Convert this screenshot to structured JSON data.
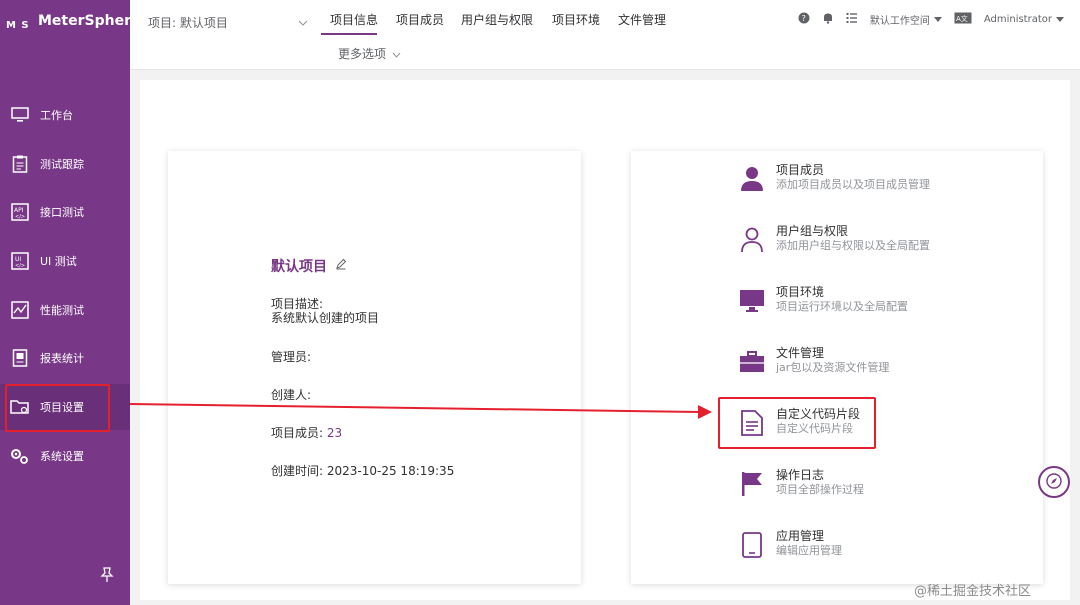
{
  "app": {
    "name": "MeterSphere",
    "mark": "M S"
  },
  "sidebar": {
    "items": [
      {
        "label": "工作台",
        "icon": "monitor-icon"
      },
      {
        "label": "测试跟踪",
        "icon": "clipboard-icon"
      },
      {
        "label": "接口测试",
        "icon": "api-icon"
      },
      {
        "label": "UI 测试",
        "icon": "ui-icon"
      },
      {
        "label": "性能测试",
        "icon": "performance-icon"
      },
      {
        "label": "报表统计",
        "icon": "report-icon"
      },
      {
        "label": "项目设置",
        "icon": "folder-gear-icon"
      },
      {
        "label": "系统设置",
        "icon": "gears-icon"
      }
    ],
    "active_index": 6,
    "pin_icon": "pin-icon"
  },
  "topbar": {
    "project_select": "项目: 默认项目",
    "tabs": [
      "项目信息",
      "项目成员",
      "用户组与权限",
      "项目环境",
      "文件管理"
    ],
    "active_tab": "项目信息",
    "more": "更多选项",
    "workspace": "默认工作空间",
    "user": "Administrator"
  },
  "project": {
    "name": "默认项目",
    "desc_label": "项目描述:",
    "desc_value": "系统默认创建的项目",
    "manager_label": "管理员:",
    "creator_label": "创建人:",
    "members_label": "项目成员:",
    "members_value": "23",
    "created_label": "创建时间:",
    "created_value": "2023-10-25 18:19:35"
  },
  "menu": [
    {
      "title": "项目成员",
      "sub": "添加项目成员以及项目成员管理",
      "icon": "user-icon"
    },
    {
      "title": "用户组与权限",
      "sub": "添加用户组与权限以及全局配置",
      "icon": "user-outline-icon"
    },
    {
      "title": "项目环境",
      "sub": "项目运行环境以及全局配置",
      "icon": "monitor-icon"
    },
    {
      "title": "文件管理",
      "sub": "jar包以及资源文件管理",
      "icon": "briefcase-icon"
    },
    {
      "title": "自定义代码片段",
      "sub": "自定义代码片段",
      "icon": "document-icon"
    },
    {
      "title": "操作日志",
      "sub": "项目全部操作过程",
      "icon": "flag-icon"
    },
    {
      "title": "应用管理",
      "sub": "编辑应用管理",
      "icon": "tablet-icon"
    }
  ],
  "colors": {
    "brand": "#783887",
    "annotation": "#e5202e"
  },
  "watermark": "@稀土掘金技术社区"
}
